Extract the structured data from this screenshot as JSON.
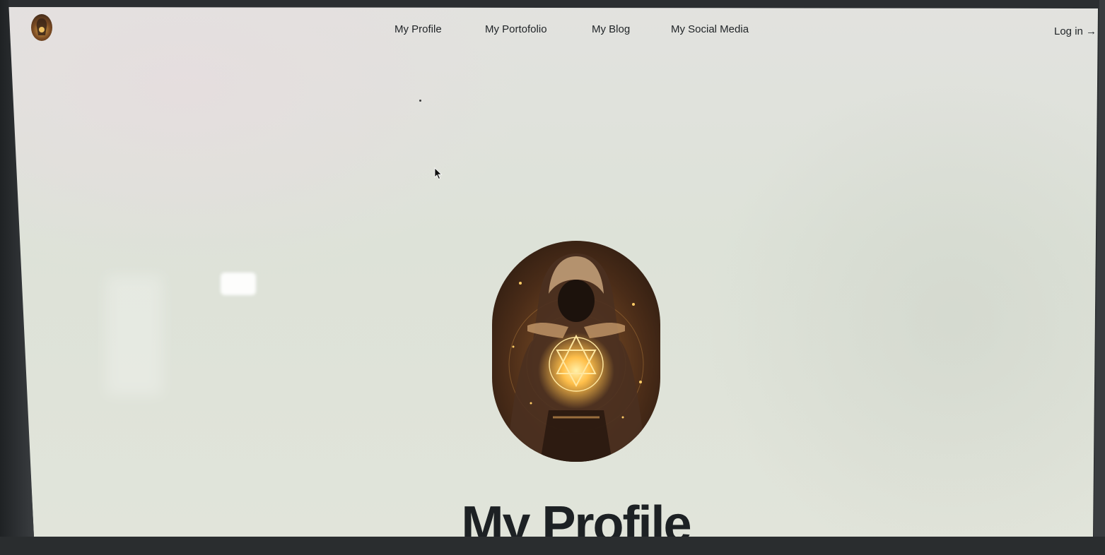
{
  "nav": {
    "items": [
      {
        "label": "My Profile"
      },
      {
        "label": "My Portofolio"
      },
      {
        "label": "My Blog"
      },
      {
        "label": "My Social Media"
      }
    ],
    "login_label": "Log in →"
  },
  "hero": {
    "title": "My Profile"
  },
  "icons": {
    "logo": "site-logo-avatar",
    "cursor": "mouse-pointer-icon"
  },
  "colors": {
    "text": "#1d2124",
    "background": "#e0e3dc"
  }
}
